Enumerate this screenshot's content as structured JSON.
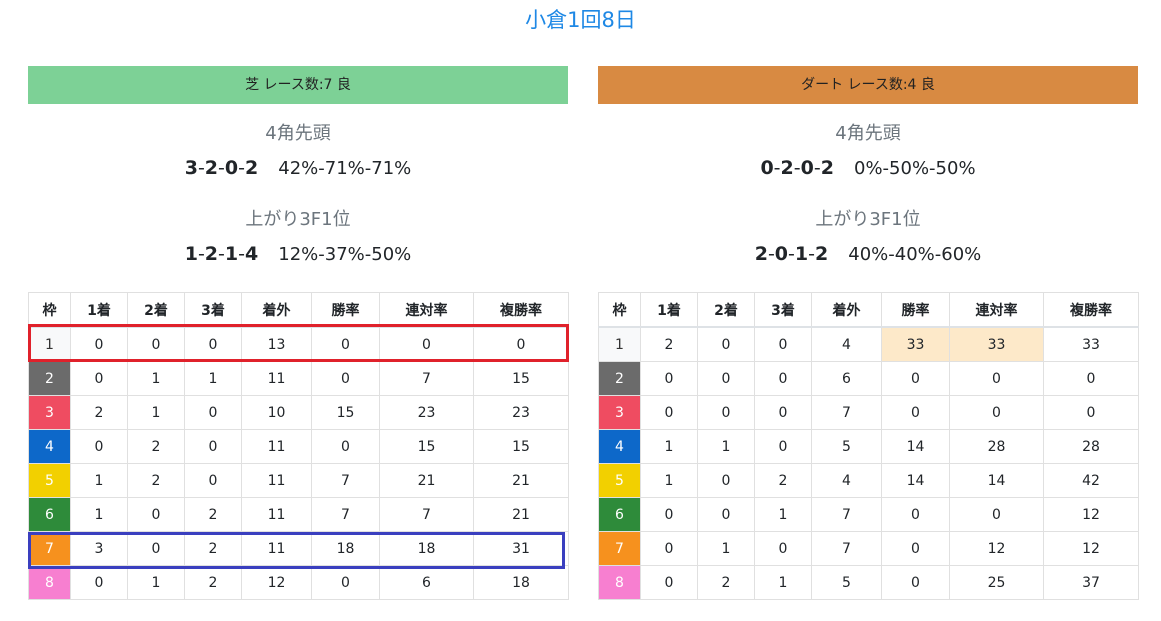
{
  "title": "小倉1回8日",
  "colors": {
    "title": "#1e88e5",
    "turf_header": "#7dd196",
    "dirt_header": "#d88a42",
    "highlight": "#fde9c9",
    "red_box": "#e0212b",
    "blue_box": "#3a3fbf"
  },
  "waku_colors": [
    "#f8f9fa",
    "#6b6b6b",
    "#ef4c61",
    "#0d68c9",
    "#f2d000",
    "#2e8b3a",
    "#f6911e",
    "#f77fd0"
  ],
  "columns": [
    "枠",
    "1着",
    "2着",
    "3着",
    "着外",
    "勝率",
    "連対率",
    "複勝率"
  ],
  "turf": {
    "header": "芝 レース数:7 良",
    "corner": {
      "title": "4角先頭",
      "record": [
        "3",
        "2",
        "0",
        "2"
      ],
      "pct": "42%-71%-71%"
    },
    "last3f": {
      "title": "上がり3F1位",
      "record": [
        "1",
        "2",
        "1",
        "4"
      ],
      "pct": "12%-37%-50%"
    },
    "rows": [
      [
        "1",
        "0",
        "0",
        "0",
        "13",
        "0",
        "0",
        "0"
      ],
      [
        "2",
        "0",
        "1",
        "1",
        "11",
        "0",
        "7",
        "15"
      ],
      [
        "3",
        "2",
        "1",
        "0",
        "10",
        "15",
        "23",
        "23"
      ],
      [
        "4",
        "0",
        "2",
        "0",
        "11",
        "0",
        "15",
        "15"
      ],
      [
        "5",
        "1",
        "2",
        "0",
        "11",
        "7",
        "21",
        "21"
      ],
      [
        "6",
        "1",
        "0",
        "2",
        "11",
        "7",
        "7",
        "21"
      ],
      [
        "7",
        "3",
        "0",
        "2",
        "11",
        "18",
        "18",
        "31"
      ],
      [
        "8",
        "0",
        "1",
        "2",
        "12",
        "0",
        "6",
        "18"
      ]
    ]
  },
  "dirt": {
    "header": "ダート レース数:4 良",
    "corner": {
      "title": "4角先頭",
      "record": [
        "0",
        "2",
        "0",
        "2"
      ],
      "pct": "0%-50%-50%"
    },
    "last3f": {
      "title": "上がり3F1位",
      "record": [
        "2",
        "0",
        "1",
        "2"
      ],
      "pct": "40%-40%-60%"
    },
    "rows": [
      [
        "1",
        "2",
        "0",
        "0",
        "4",
        "33",
        "33",
        "33"
      ],
      [
        "2",
        "0",
        "0",
        "0",
        "6",
        "0",
        "0",
        "0"
      ],
      [
        "3",
        "0",
        "0",
        "0",
        "7",
        "0",
        "0",
        "0"
      ],
      [
        "4",
        "1",
        "1",
        "0",
        "5",
        "14",
        "28",
        "28"
      ],
      [
        "5",
        "1",
        "0",
        "2",
        "4",
        "14",
        "14",
        "42"
      ],
      [
        "6",
        "0",
        "0",
        "1",
        "7",
        "0",
        "0",
        "12"
      ],
      [
        "7",
        "0",
        "1",
        "0",
        "7",
        "0",
        "12",
        "12"
      ],
      [
        "8",
        "0",
        "2",
        "1",
        "5",
        "0",
        "25",
        "37"
      ]
    ],
    "highlight_cells": [
      [
        0,
        5
      ],
      [
        0,
        6
      ]
    ]
  }
}
